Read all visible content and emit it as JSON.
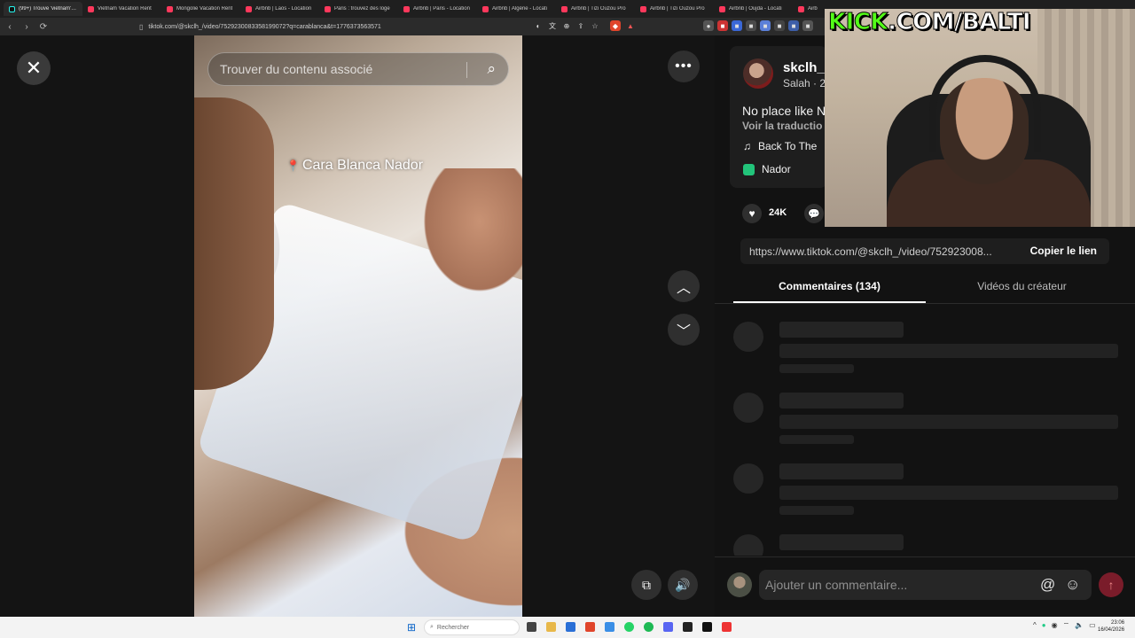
{
  "browser": {
    "tabs": [
      {
        "label": "(99+) Trouve 'vietnam' su",
        "favicon": "tiktok-icon"
      },
      {
        "label": "Vietnam Vacation Rent",
        "favicon": "airbnb-icon"
      },
      {
        "label": "Mongolie Vacation Rent",
        "favicon": "airbnb-icon"
      },
      {
        "label": "Airbnb | Laos - Location",
        "favicon": "airbnb-icon"
      },
      {
        "label": "Paris : trouvez des loge",
        "favicon": "airbnb-icon"
      },
      {
        "label": "Airbnb | Paris - Location",
        "favicon": "airbnb-icon"
      },
      {
        "label": "Airbnb | Algérie - Locati",
        "favicon": "airbnb-icon"
      },
      {
        "label": "Airbnb | Tizi Ouzou Pro",
        "favicon": "airbnb-icon"
      },
      {
        "label": "Airbnb | Tizi Ouzou Pro",
        "favicon": "airbnb-icon"
      },
      {
        "label": "Airbnb | Oujda - Locati",
        "favicon": "airbnb-icon"
      },
      {
        "label": "Airb",
        "favicon": "airbnb-icon"
      }
    ],
    "url": "tiktok.com/@skclh_/video/7529230083358199072?q=carablanca&t=1776373563571"
  },
  "video": {
    "search_placeholder": "Trouver du contenu associé",
    "location_tag": "Cara Blanca Nador"
  },
  "post": {
    "username": "skclh_",
    "subname": "Salah · 2",
    "caption": "No place like N",
    "translate_label": "Voir la traductio",
    "music": "Back To The",
    "place": "Nador",
    "likes": "24K",
    "link": "https://www.tiktok.com/@skclh_/video/752923008...",
    "copy_label": "Copier le lien"
  },
  "tabs": {
    "comments": "Commentaires (134)",
    "creator_videos": "Vidéos du créateur"
  },
  "comment_box": {
    "placeholder": "Ajouter un commentaire...",
    "at_symbol": "@"
  },
  "overlay": {
    "kick_brand": "KICK",
    "kick_rest": ".COM/BALTI"
  },
  "taskbar": {
    "search_label": "Rechercher",
    "time": "23:06",
    "date": "16/04/2026"
  },
  "colors": {
    "tiktok_red": "#fe2c55",
    "kick_green": "#53fc18",
    "panel_bg": "#121212"
  }
}
